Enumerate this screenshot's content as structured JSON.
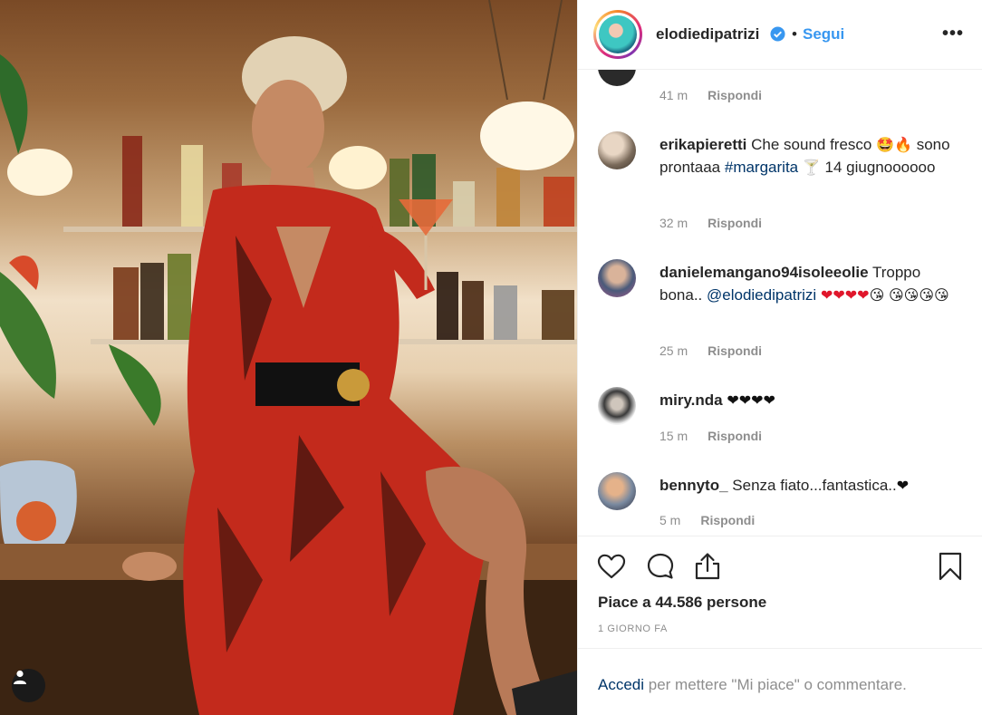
{
  "post": {
    "username": "elodiedipatrizi",
    "separator": "•",
    "follow_label": "Segui",
    "more_label": "•••"
  },
  "comments": [
    {
      "time": "41 m",
      "reply_label": "Rispondi"
    },
    {
      "username": "erikapieretti",
      "text_a": "Che sound fresco",
      "emoji_a": "🤩🔥",
      "text_b": "sono prontaaa",
      "hashtag": "#margarita",
      "emoji_b": "🍸",
      "text_c": "14 giugnoooooo",
      "time": "32 m",
      "reply_label": "Rispondi"
    },
    {
      "username": "danielemangano94isoleeolie",
      "text_a": "Troppo bona..",
      "mention": "@elodiedipatrizi",
      "hearts": "❤❤❤❤",
      "emoji_a": "😘",
      "emoji_b": "😘😘😘😘",
      "time": "25 m",
      "reply_label": "Rispondi"
    },
    {
      "username": "miry.nda",
      "hearts": "❤❤❤❤",
      "time": "15 m",
      "reply_label": "Rispondi"
    },
    {
      "username": "bennyto_",
      "text_a": "Senza fiato...fantastica..",
      "heart": "❤",
      "time": "5 m",
      "reply_label": "Rispondi"
    }
  ],
  "actions": {
    "likes_text": "Piace a 44.586 persone",
    "time_ago": "1 GIORNO FA"
  },
  "login": {
    "link_label": "Accedi",
    "rest": "per mettere \"Mi piace\" o commentare."
  },
  "colors": {
    "link_blue": "#3897f0",
    "dark_link": "#003569",
    "meta_gray": "#8e8e8e"
  }
}
